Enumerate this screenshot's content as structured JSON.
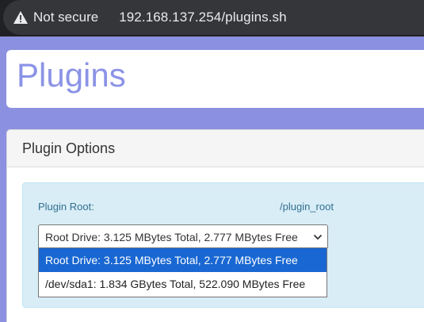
{
  "browser": {
    "security_label": "Not secure",
    "url": "192.168.137.254/plugins.sh"
  },
  "page": {
    "title": "Plugins"
  },
  "panel": {
    "heading": "Plugin Options",
    "plugin_root_label": "Plugin Root:",
    "plugin_root_value": "/plugin_root",
    "drive_select": {
      "selected": "Root Drive: 3.125 MBytes Total, 2.777 MBytes Free",
      "options": [
        "Root Drive: 3.125 MBytes Total, 2.777 MBytes Free",
        "/dev/sda1: 1.834 GBytes Total, 522.090 MBytes Free"
      ]
    }
  },
  "icons": {
    "security": "warning-triangle-icon",
    "select": "chevron-down-icon"
  },
  "colors": {
    "page_background": "#8b90e0",
    "title": "#8b93e6",
    "info_background": "#d9edf7",
    "info_text": "#31708f",
    "highlight": "#1967d2"
  }
}
